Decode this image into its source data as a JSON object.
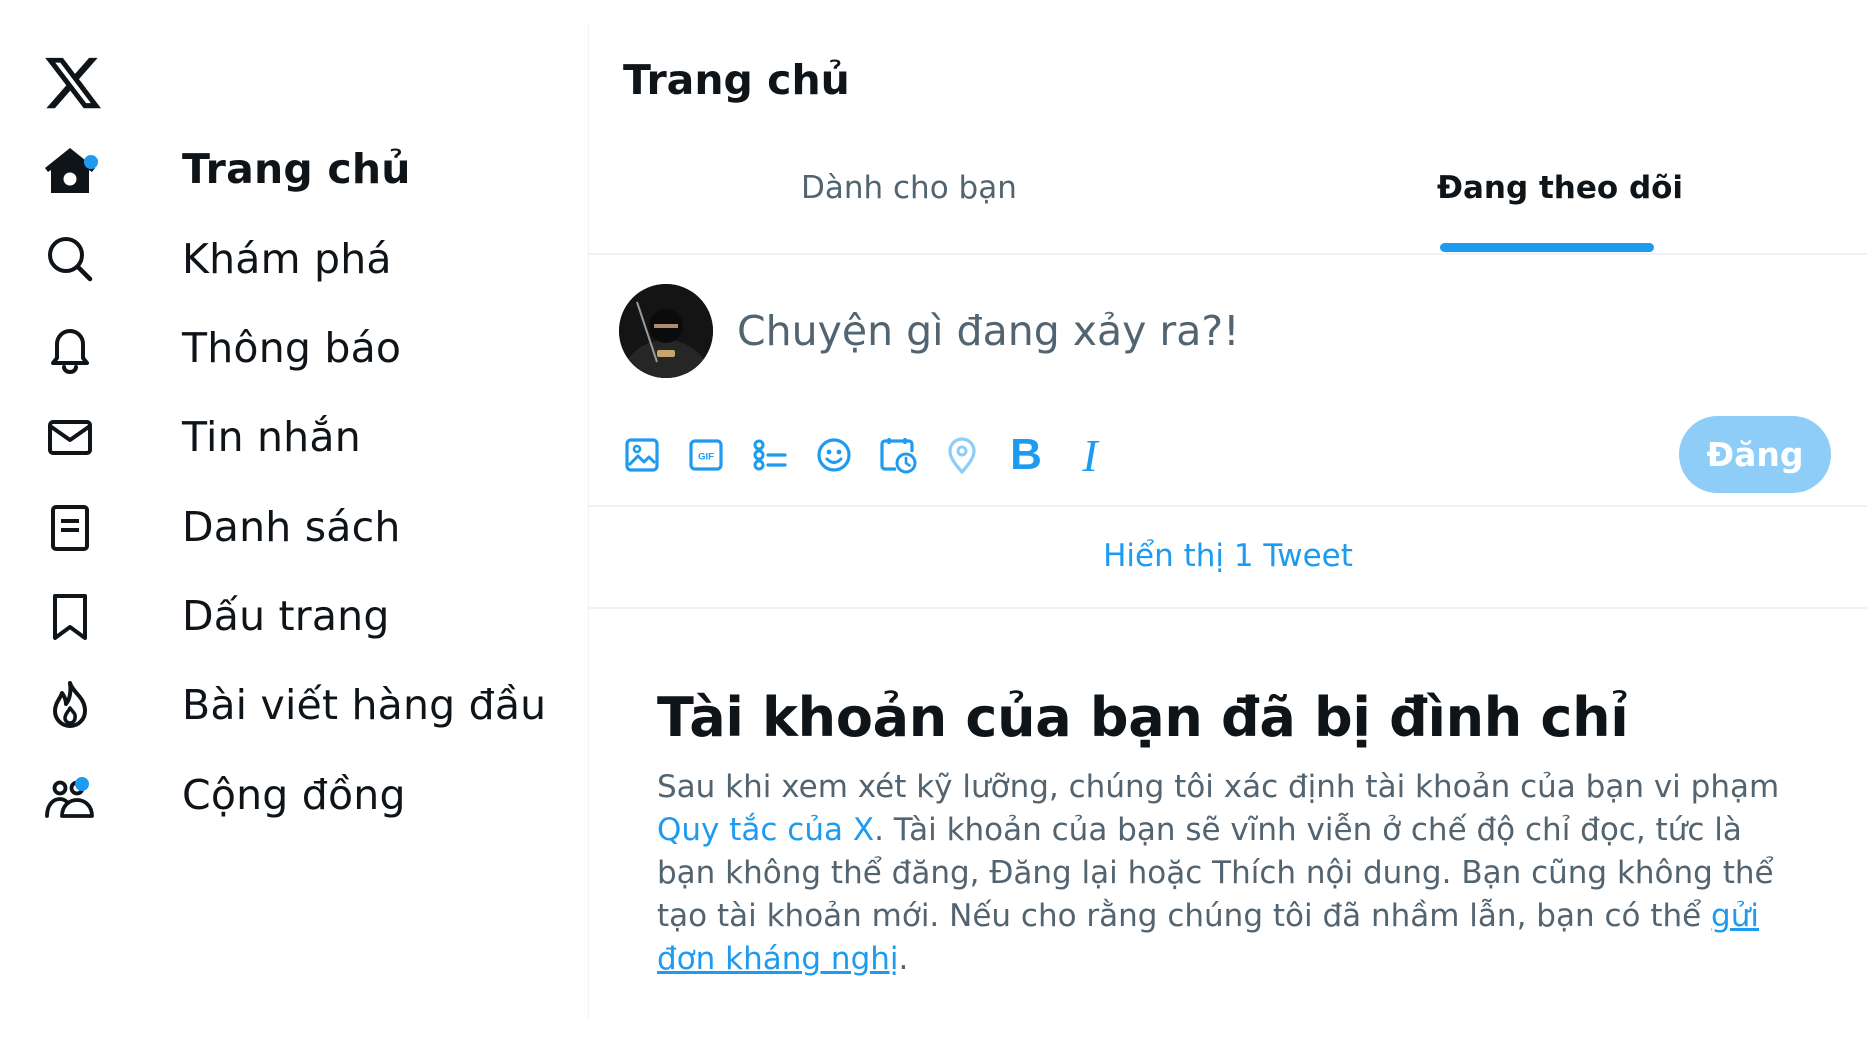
{
  "colors": {
    "accent": "#1d9bf0",
    "text": "#0f1419",
    "muted": "#536471",
    "post_button_disabled": "#8ecdf8"
  },
  "logo": {
    "icon": "x-logo-icon"
  },
  "sidebar": {
    "items": [
      {
        "label": "Trang chủ",
        "icon": "home-icon",
        "active": true,
        "notification_dot": true
      },
      {
        "label": "Khám phá",
        "icon": "search-icon"
      },
      {
        "label": "Thông báo",
        "icon": "bell-icon"
      },
      {
        "label": "Tin nhắn",
        "icon": "envelope-icon"
      },
      {
        "label": "Danh sách",
        "icon": "list-icon"
      },
      {
        "label": "Dấu trang",
        "icon": "bookmark-icon"
      },
      {
        "label": "Bài viết hàng đầu",
        "icon": "flame-icon"
      },
      {
        "label": "Cộng đồng",
        "icon": "communities-icon",
        "notification_dot": true
      }
    ]
  },
  "header": {
    "title": "Trang chủ"
  },
  "tabs": [
    {
      "label": "Dành cho bạn",
      "active": false
    },
    {
      "label": "Đang theo dõi",
      "active": true
    }
  ],
  "composer": {
    "placeholder": "Chuyện gì đang xảy ra?!",
    "tools": [
      "image-icon",
      "gif-icon",
      "poll-icon",
      "emoji-icon",
      "schedule-icon",
      "location-icon",
      "bold-icon",
      "italic-icon"
    ],
    "bold_glyph": "B",
    "italic_glyph": "I",
    "post_label": "Đăng"
  },
  "timeline": {
    "show_new": "Hiển thị 1 Tweet"
  },
  "suspension": {
    "title": "Tài khoản của bạn đã bị đình chỉ",
    "text_1": "Sau khi xem xét kỹ lưỡng, chúng tôi xác định tài khoản của bạn vi phạm ",
    "link_rules": "Quy tắc của X",
    "text_2": ". Tài khoản của bạn sẽ vĩnh viễn ở chế độ chỉ đọc, tức là bạn không thể đăng, Đăng lại hoặc Thích nội dung. Bạn cũng không thể tạo tài khoản mới. Nếu cho rằng chúng tôi đã nhầm lẫn, bạn có thể ",
    "link_appeal": "gửi đơn kháng nghị",
    "text_3": "."
  }
}
